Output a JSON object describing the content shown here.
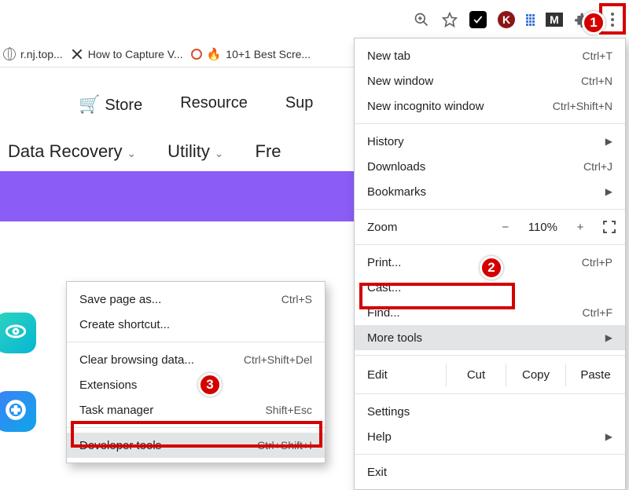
{
  "toolbar": {
    "ext_k_letter": "K",
    "ext_m_letter": "M"
  },
  "bookmarks": {
    "items": [
      "r.nj.top...",
      "How to Capture V...",
      "10+1 Best Scre..."
    ]
  },
  "site": {
    "nav1": [
      "Store",
      "Resource",
      "Sup"
    ],
    "nav2": [
      "Data Recovery",
      "Utility",
      "Fre"
    ]
  },
  "main_menu": {
    "new_tab": {
      "label": "New tab",
      "shortcut": "Ctrl+T"
    },
    "new_window": {
      "label": "New window",
      "shortcut": "Ctrl+N"
    },
    "new_incognito": {
      "label": "New incognito window",
      "shortcut": "Ctrl+Shift+N"
    },
    "history": {
      "label": "History"
    },
    "downloads": {
      "label": "Downloads",
      "shortcut": "Ctrl+J"
    },
    "bookmarks": {
      "label": "Bookmarks"
    },
    "zoom": {
      "label": "Zoom",
      "value": "110%"
    },
    "print": {
      "label": "Print...",
      "shortcut": "Ctrl+P"
    },
    "cast": {
      "label": "Cast..."
    },
    "find": {
      "label": "Find...",
      "shortcut": "Ctrl+F"
    },
    "more_tools": {
      "label": "More tools"
    },
    "edit": {
      "label": "Edit",
      "cut": "Cut",
      "copy": "Copy",
      "paste": "Paste"
    },
    "settings": {
      "label": "Settings"
    },
    "help": {
      "label": "Help"
    },
    "exit": {
      "label": "Exit"
    }
  },
  "sub_menu": {
    "save_as": {
      "label": "Save page as...",
      "shortcut": "Ctrl+S"
    },
    "create_shortcut": {
      "label": "Create shortcut..."
    },
    "clear_browsing": {
      "label": "Clear browsing data...",
      "shortcut": "Ctrl+Shift+Del"
    },
    "extensions": {
      "label": "Extensions"
    },
    "task_manager": {
      "label": "Task manager",
      "shortcut": "Shift+Esc"
    },
    "dev_tools": {
      "label": "Developer tools",
      "shortcut": "Ctrl+Shift+I"
    }
  },
  "badges": {
    "b1": "1",
    "b2": "2",
    "b3": "3"
  }
}
